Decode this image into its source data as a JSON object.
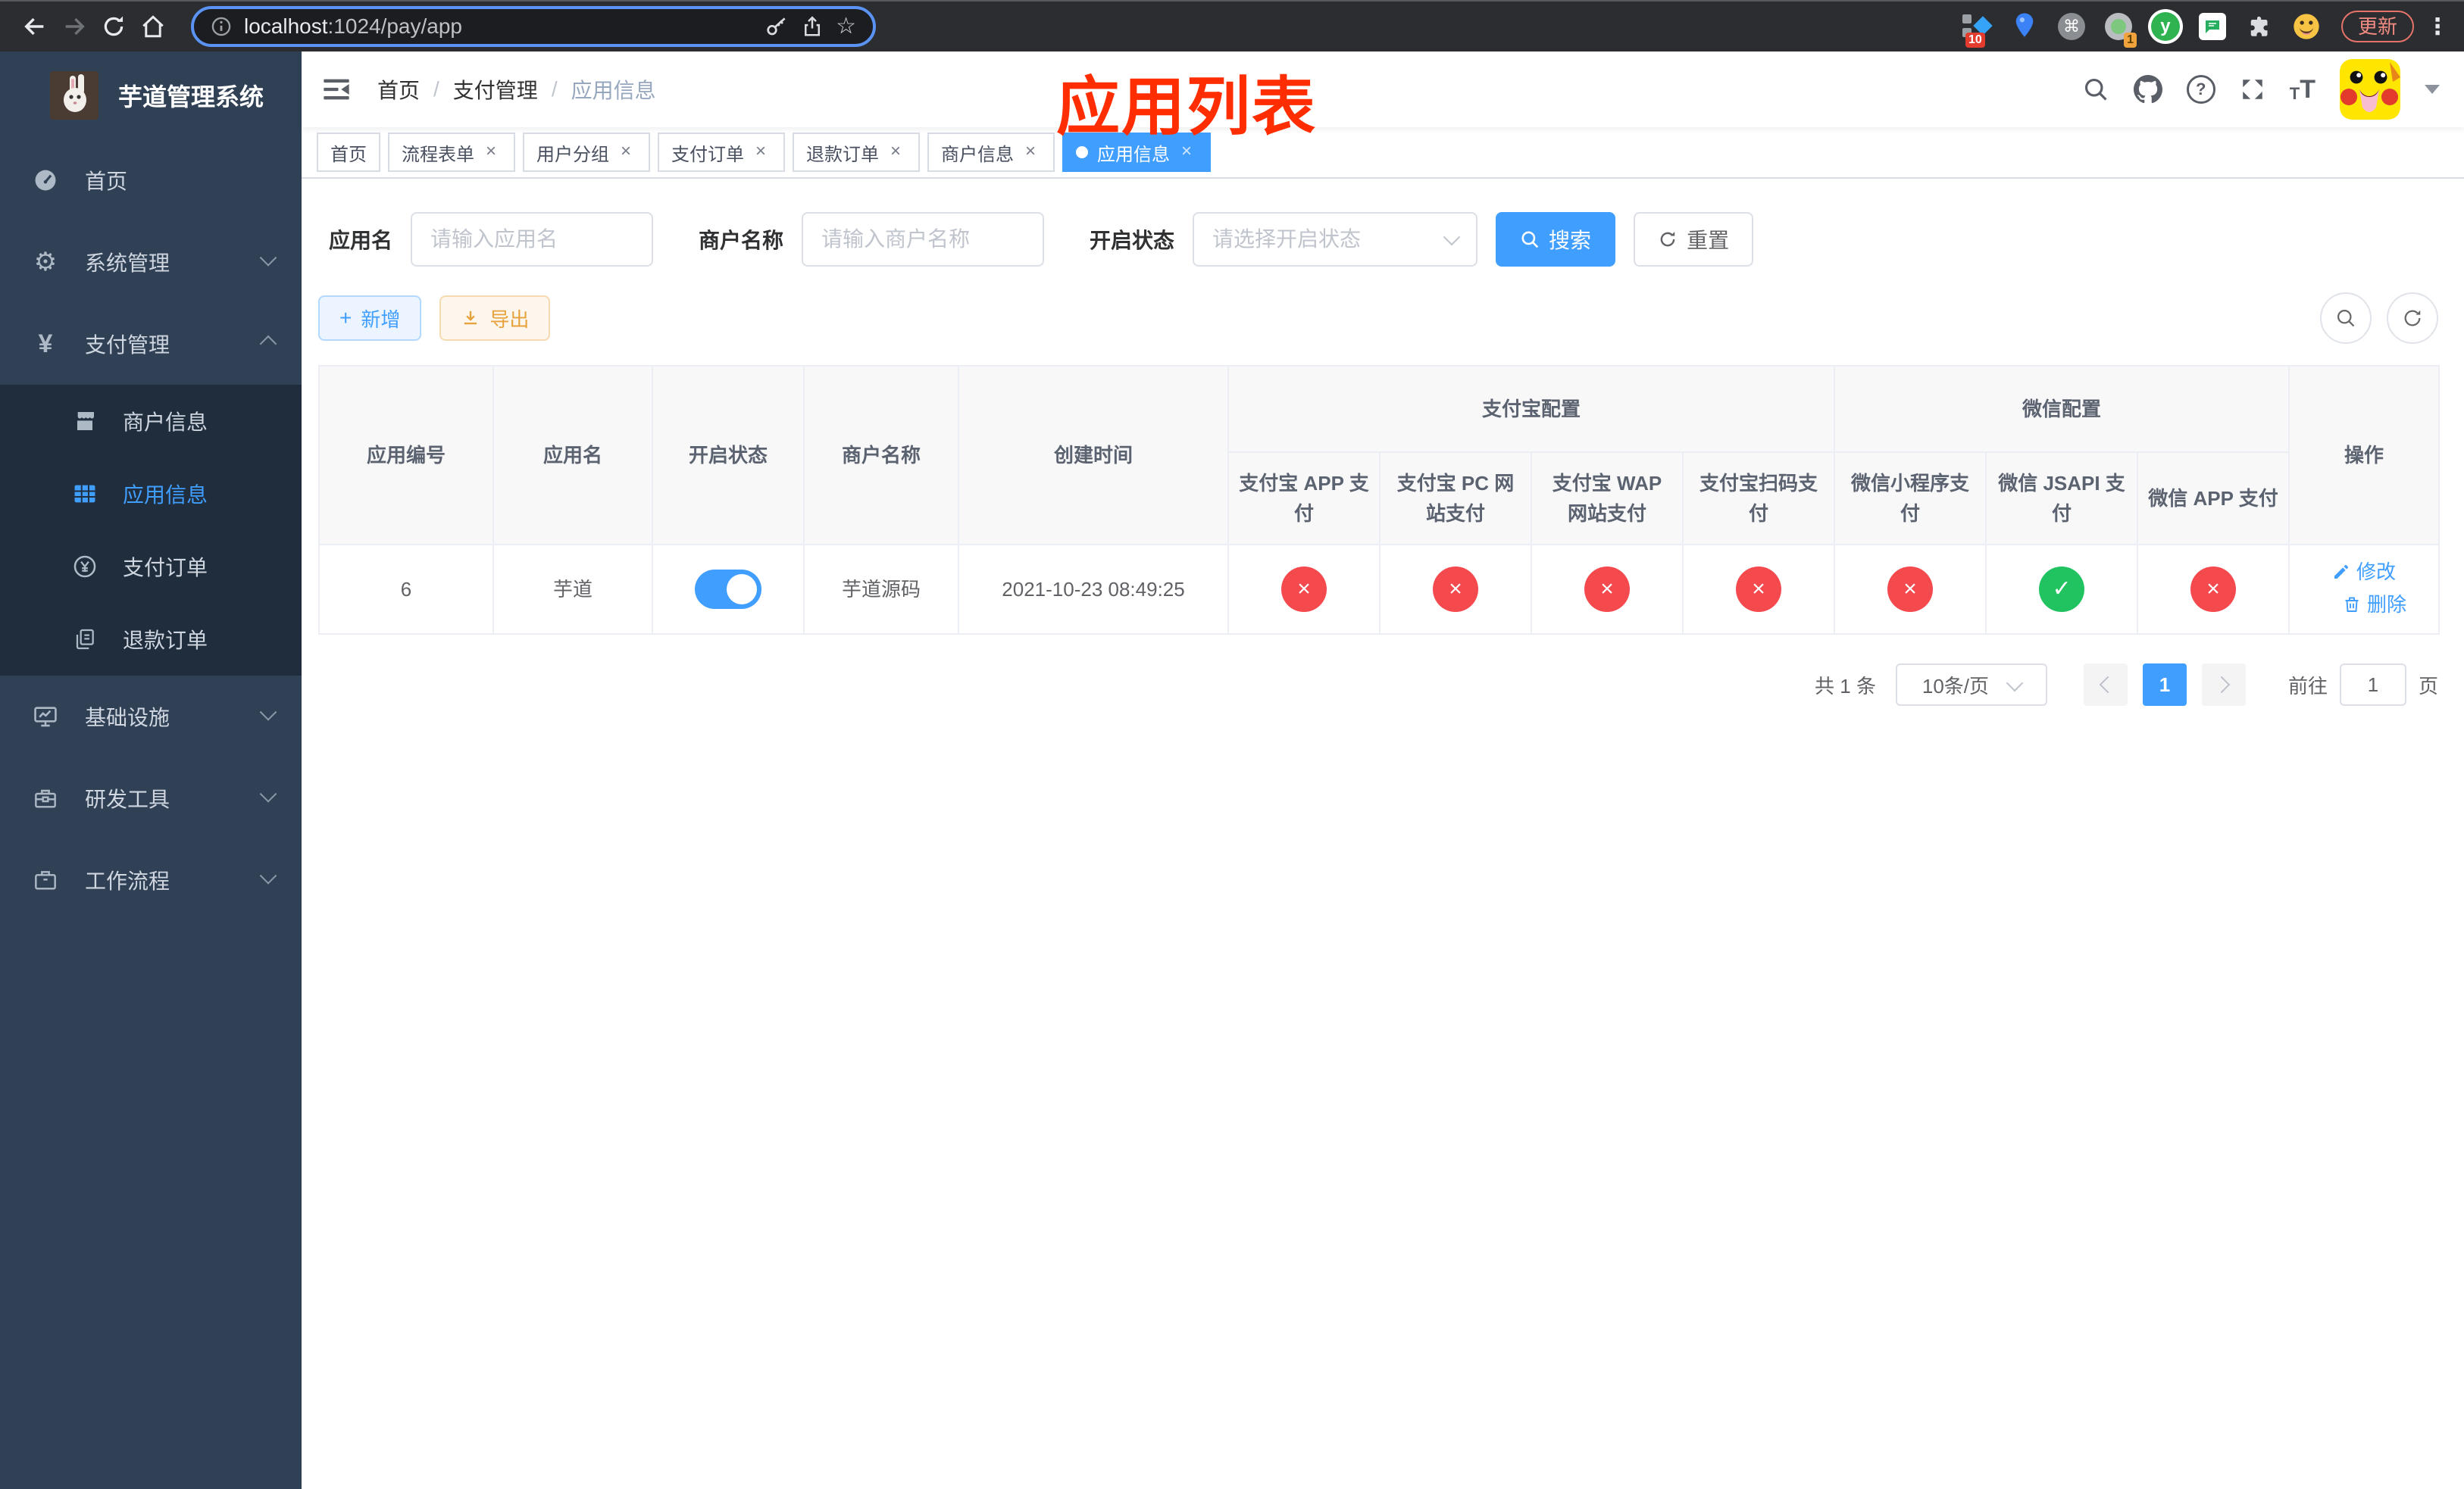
{
  "browser": {
    "url_host": "localhost",
    "url_rest": ":1024/pay/app",
    "update_label": "更新",
    "badge_pin": "10",
    "badge_proxy": "1"
  },
  "icons": {
    "yen": "¥",
    "gear": "⚙",
    "star": "☆",
    "dots": "⋮",
    "cmd": "⌘",
    "question": "?",
    "plus": "+",
    "cross": "×",
    "check": "✓",
    "slash": "/",
    "y_letter": "y",
    "t_small": "T",
    "t_large": "T"
  },
  "sidebar": {
    "title": "芋道管理系统",
    "items": [
      {
        "label": "首页"
      },
      {
        "label": "系统管理"
      },
      {
        "label": "支付管理"
      },
      {
        "label": "基础设施"
      },
      {
        "label": "研发工具"
      },
      {
        "label": "工作流程"
      }
    ],
    "submenu": [
      {
        "label": "商户信息"
      },
      {
        "label": "应用信息"
      },
      {
        "label": "支付订单"
      },
      {
        "label": "退款订单"
      }
    ]
  },
  "navbar": {
    "breadcrumb": [
      "首页",
      "支付管理",
      "应用信息"
    ]
  },
  "annotation": {
    "text": "应用列表",
    "color": "#FF2D00"
  },
  "tags": [
    {
      "label": "首页",
      "closable": false,
      "active": false
    },
    {
      "label": "流程表单",
      "closable": true,
      "active": false
    },
    {
      "label": "用户分组",
      "closable": true,
      "active": false
    },
    {
      "label": "支付订单",
      "closable": true,
      "active": false
    },
    {
      "label": "退款订单",
      "closable": true,
      "active": false
    },
    {
      "label": "商户信息",
      "closable": true,
      "active": false
    },
    {
      "label": "应用信息",
      "closable": true,
      "active": true
    }
  ],
  "filters": {
    "app_name_label": "应用名",
    "app_name_placeholder": "请输入应用名",
    "merchant_label": "商户名称",
    "merchant_placeholder": "请输入商户名称",
    "status_label": "开启状态",
    "status_placeholder": "请选择开启状态",
    "search_label": "搜索",
    "reset_label": "重置"
  },
  "toolbar": {
    "add_label": "新增",
    "export_label": "导出"
  },
  "table": {
    "col_app_id": "应用编号",
    "col_app_name": "应用名",
    "col_status": "开启状态",
    "col_merchant": "商户名称",
    "col_created": "创建时间",
    "group_alipay": "支付宝配置",
    "group_wechat": "微信配置",
    "col_actions": "操作",
    "sub_columns": [
      "支付宝 APP 支付",
      "支付宝 PC 网站支付",
      "支付宝 WAP 网站支付",
      "支付宝扫码支付",
      "微信小程序支付",
      "微信 JSAPI 支付",
      "微信 APP 支付"
    ],
    "row": {
      "app_id": "6",
      "app_name": "芋道",
      "enabled": true,
      "merchant": "芋道源码",
      "created": "2021-10-23 08:49:25",
      "channels": [
        false,
        false,
        false,
        false,
        false,
        true,
        false
      ],
      "edit_label": "修改",
      "delete_label": "删除"
    }
  },
  "pagination": {
    "total": "共 1 条",
    "page_size": "10条/页",
    "current_page": "1",
    "goto_prefix": "前往",
    "goto_value": "1",
    "goto_suffix": "页"
  },
  "colors": {
    "primary": "#409EFF",
    "danger": "#F4494D",
    "success": "#21C361",
    "sidebar_bg": "#304156",
    "submenu_bg": "#1f2d3d"
  }
}
